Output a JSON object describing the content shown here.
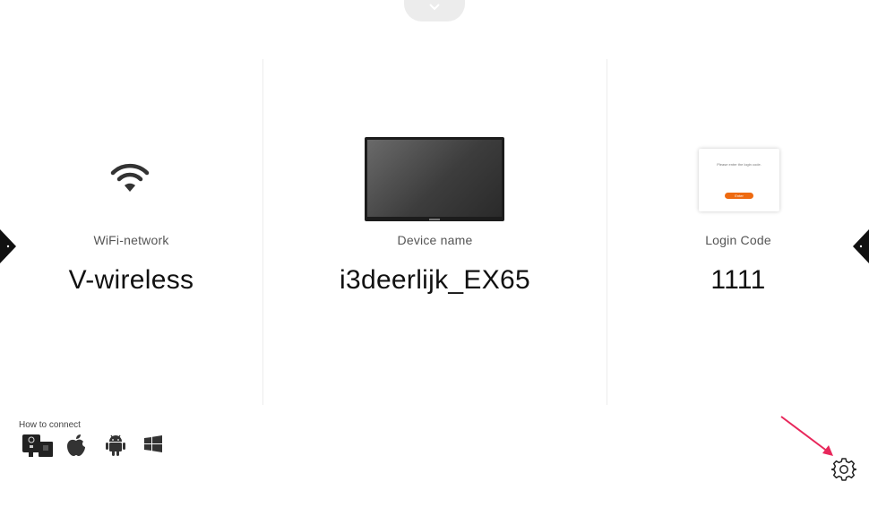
{
  "wifi": {
    "label": "WiFi-network",
    "value": "V-wireless"
  },
  "device": {
    "label": "Device name",
    "value": "i3deerlijk_EX65"
  },
  "login": {
    "label": "Login Code",
    "value": "1111",
    "preview_prompt": "Please enter the login code.",
    "preview_button": "Enter"
  },
  "connect": {
    "label": "How to connect",
    "icons": [
      "dongle-icon",
      "apple-icon",
      "android-icon",
      "windows-icon"
    ]
  },
  "colors": {
    "accent": "#ee6a10",
    "annotation": "#e8275b",
    "icon": "#333333"
  }
}
